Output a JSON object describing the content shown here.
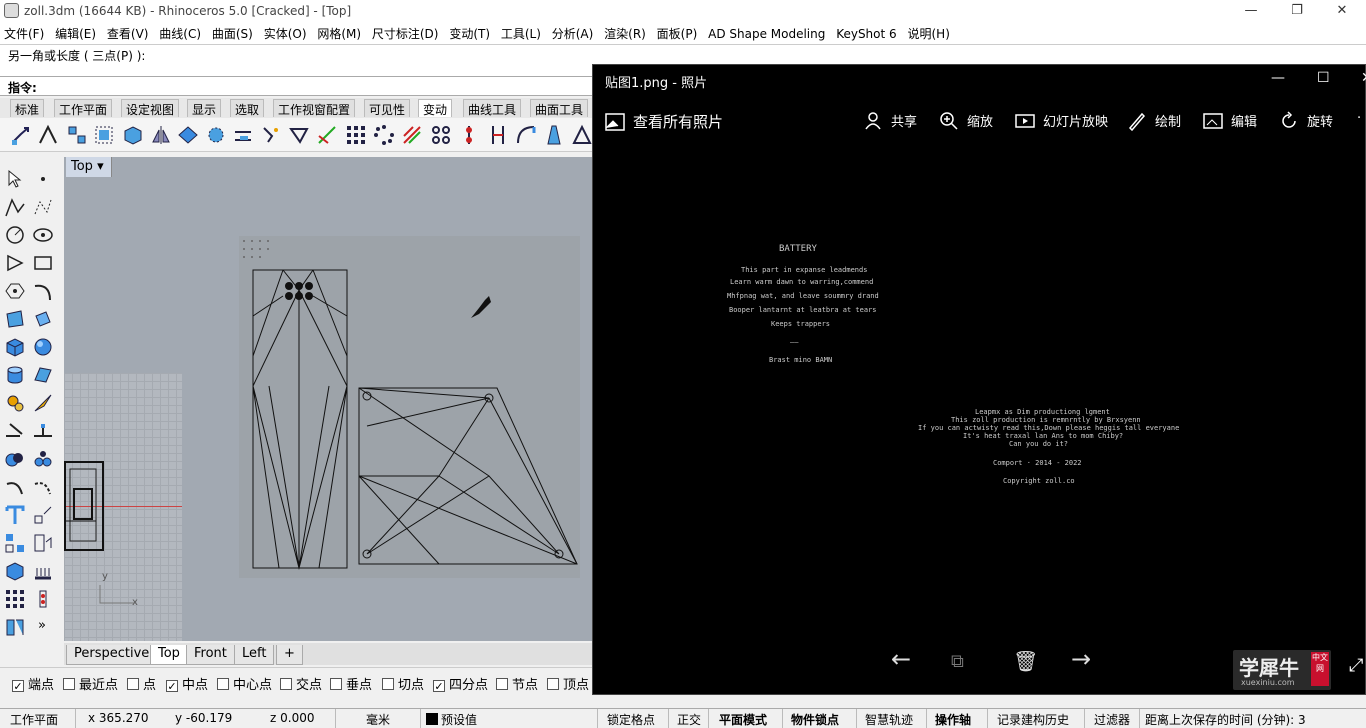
{
  "window": {
    "title": "zoll.3dm (16644 KB) - Rhinoceros 5.0 [Cracked] - [Top]"
  },
  "menu": [
    "文件(F)",
    "编辑(E)",
    "查看(V)",
    "曲线(C)",
    "曲面(S)",
    "实体(O)",
    "网格(M)",
    "尺寸标注(D)",
    "变动(T)",
    "工具(L)",
    "分析(A)",
    "渲染(R)",
    "面板(P)",
    "AD Shape Modeling",
    "KeyShot 6",
    "说明(H)"
  ],
  "command": {
    "history": "另一角或长度 ( 三点(P) ):",
    "prompt": "指令:"
  },
  "toolbar_tabs": [
    "标准",
    "工作平面",
    "设定视图",
    "显示",
    "选取",
    "工作视窗配置",
    "可见性",
    "变动",
    "曲线工具",
    "曲面工具"
  ],
  "viewport": {
    "label": "Top",
    "axis_y": "y",
    "axis_x": "x"
  },
  "viewport_tabs": [
    "Perspective",
    "Top",
    "Front",
    "Left",
    "+"
  ],
  "osnap": [
    {
      "label": "端点",
      "checked": true
    },
    {
      "label": "最近点",
      "checked": false
    },
    {
      "label": "点",
      "checked": false
    },
    {
      "label": "中点",
      "checked": true
    },
    {
      "label": "中心点",
      "checked": false
    },
    {
      "label": "交点",
      "checked": false
    },
    {
      "label": "垂点",
      "checked": false
    },
    {
      "label": "切点",
      "checked": false
    },
    {
      "label": "四分点",
      "checked": true
    },
    {
      "label": "节点",
      "checked": false
    },
    {
      "label": "顶点",
      "checked": false
    }
  ],
  "status": {
    "cplane": "工作平面",
    "x": "x 365.270",
    "y": "y -60.179",
    "z": "z 0.000",
    "unit": "毫米",
    "layer": "预设值",
    "grid_snap": "锁定格点",
    "ortho": "正交",
    "planar": "平面模式",
    "osnap": "物件锁点",
    "smarttrack": "智慧轨迹",
    "gumball": "操作轴",
    "history": "记录建构历史",
    "filter": "过滤器",
    "autosave": "距离上次保存的时间 (分钟): 3"
  },
  "photos": {
    "title": "贴图1.png - 照片",
    "view_all": "查看所有照片",
    "share": "共享",
    "zoom": "缩放",
    "slideshow": "幻灯片放映",
    "draw": "绘制",
    "edit": "编辑",
    "rotate": "旋转",
    "image_text": {
      "heading": "BATTERY",
      "l1": "This part in expanse leadmends",
      "l2": "Learn warm dawn to warring,commend",
      "l3": "Mhfpnag wat, and leave soummry drand",
      "l4": "Booper lantarnt at leatbra at tears",
      "l5": "Keeps trappers",
      "sep": "——",
      "sig": "Brast mino BAMN",
      "b1": "Leapmx as Dim productiong lgment",
      "b2": "This zoll production is remnrntly by Brxsyenn",
      "b3": "If you can actwisty read this,Down please heggis tall everyane",
      "b4": "It's heat traxal lan Ans to mom Chiby?",
      "b5": "Can you do it?",
      "c1": "Comport  ·  2014 - 2022",
      "c2": "Copyright zoll.co"
    },
    "watermark": {
      "main": "学犀牛",
      "url": "xuexiniu.com",
      "badge": "中文网"
    }
  }
}
